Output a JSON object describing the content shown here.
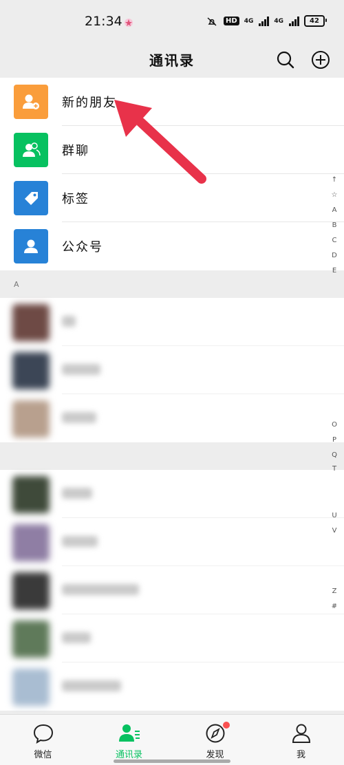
{
  "status_bar": {
    "time": "21:34",
    "hd_label": "HD",
    "net1": "4G",
    "net2": "4G",
    "battery": "42"
  },
  "header": {
    "title": "通讯录",
    "search_icon": "search-icon",
    "add_icon": "plus-circle-icon"
  },
  "functions": [
    {
      "label": "新的朋友",
      "icon": "add-friend-icon",
      "color": "#fa9d3b"
    },
    {
      "label": "群聊",
      "icon": "group-icon",
      "color": "#07c160"
    },
    {
      "label": "标签",
      "icon": "tag-icon",
      "color": "#2782d7"
    },
    {
      "label": "公众号",
      "icon": "official-account-icon",
      "color": "#2782d7"
    }
  ],
  "sections": [
    {
      "letter": "A",
      "count": 3
    },
    {
      "letter": "",
      "count": 5
    }
  ],
  "alpha_index": [
    "↑",
    "☆",
    "A",
    "B",
    "C",
    "D",
    "E",
    "O",
    "P",
    "Q",
    "T",
    "U",
    "V",
    "Z",
    "#"
  ],
  "tabbar": {
    "tabs": [
      {
        "label": "微信",
        "icon": "chat-icon"
      },
      {
        "label": "通讯录",
        "icon": "contacts-icon",
        "active": true
      },
      {
        "label": "发现",
        "icon": "compass-icon",
        "badge": true
      },
      {
        "label": "我",
        "icon": "me-icon"
      }
    ]
  },
  "colors": {
    "accent": "#07c160",
    "annotation_arrow": "#e8324a"
  }
}
